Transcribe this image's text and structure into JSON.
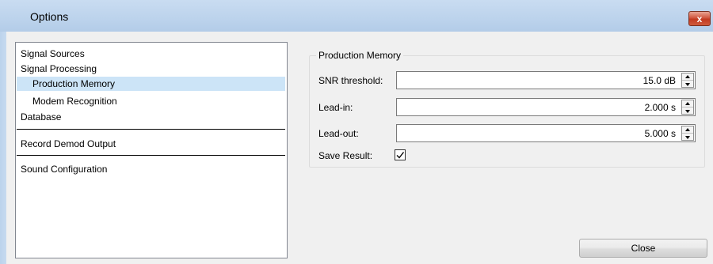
{
  "window": {
    "title": "Options",
    "close_glyph": "x",
    "accent_color": "#cce4f7"
  },
  "nav": {
    "items": [
      {
        "label": "Signal Sources",
        "selected": false
      },
      {
        "label": "Signal Processing",
        "selected": false
      },
      {
        "label": "Production Memory",
        "selected": true
      },
      {
        "label": "Modem Recognition",
        "selected": false
      },
      {
        "label": "Database",
        "selected": false
      },
      {
        "label": "Record Demod Output",
        "selected": false
      },
      {
        "label": "Sound Configuration",
        "selected": false
      }
    ]
  },
  "group": {
    "title": "Production Memory",
    "fields": [
      {
        "label": "SNR threshold:",
        "value": "15.0 dB"
      },
      {
        "label": "Lead-in:",
        "value": "2.000 s"
      },
      {
        "label": "Lead-out:",
        "value": "5.000 s"
      }
    ],
    "save_result": {
      "label": "Save Result:",
      "checked": true
    }
  },
  "footer": {
    "close_label": "Close"
  }
}
